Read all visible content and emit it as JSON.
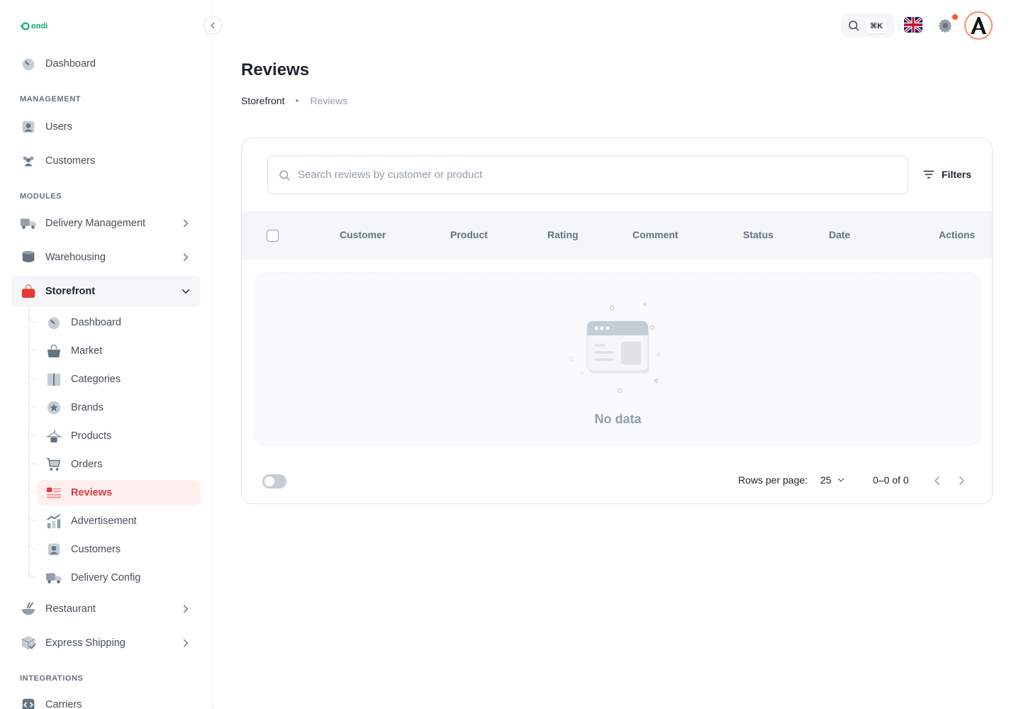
{
  "app": {
    "logo_text": "ondi"
  },
  "sidebar": {
    "dashboard": "Dashboard",
    "section_management": "MANAGEMENT",
    "users": "Users",
    "customers": "Customers",
    "section_modules": "MODULES",
    "delivery_management": "Delivery Management",
    "warehousing": "Warehousing",
    "storefront": "Storefront",
    "storefront_items": [
      "Dashboard",
      "Market",
      "Categories",
      "Brands",
      "Products",
      "Orders",
      "Reviews",
      "Advertisement",
      "Customers",
      "Delivery Config"
    ],
    "restaurant": "Restaurant",
    "express_shipping": "Express Shipping",
    "section_integrations": "INTEGRATIONS",
    "carriers": "Carriers",
    "active_color": "#e53935"
  },
  "topbar": {
    "shortcut": "⌘K",
    "language": "English (UK)",
    "notification_color": "#ff5630"
  },
  "page": {
    "title": "Reviews",
    "breadcrumb": [
      "Storefront",
      "Reviews"
    ]
  },
  "table": {
    "search_placeholder": "Search reviews by customer or product",
    "filters_label": "Filters",
    "columns": [
      "Customer",
      "Product",
      "Rating",
      "Comment",
      "Status",
      "Date",
      "Actions"
    ],
    "empty_text": "No data"
  },
  "pagination": {
    "rows_per_page_label": "Rows per page:",
    "rows_per_page": "25",
    "range": "0–0 of 0"
  }
}
